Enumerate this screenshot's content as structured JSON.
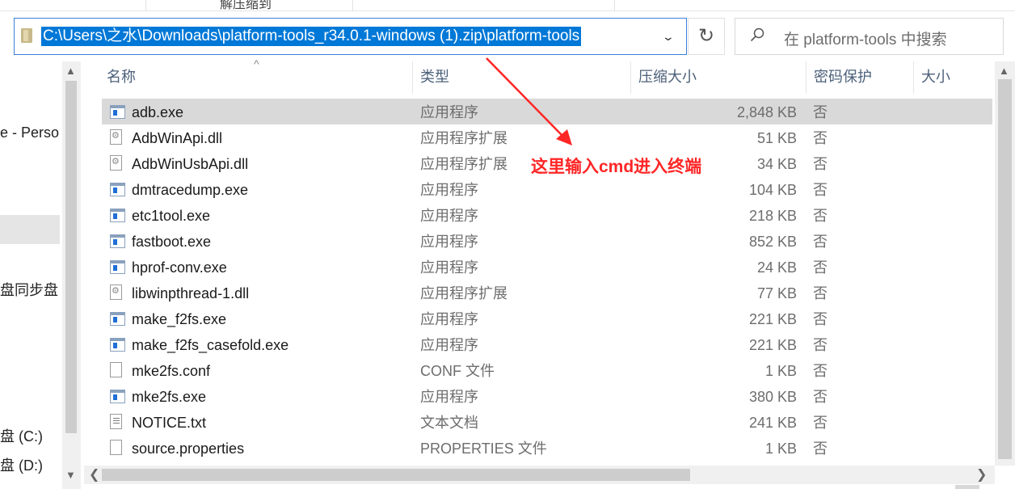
{
  "ribbon": {
    "label": "解压缩到"
  },
  "address": {
    "path": "C:\\Users\\之水\\Downloads\\platform-tools_r34.0.1-windows (1).zip\\platform-tools",
    "dropdown_icon": "chevron-down-icon",
    "refresh_icon": "refresh-icon"
  },
  "search": {
    "placeholder": "在 platform-tools 中搜索",
    "icon": "search-icon"
  },
  "nav": {
    "items": [
      {
        "label": "e - Perso"
      },
      {
        "label": "盘同步盘"
      },
      {
        "label": "盘 (C:)"
      },
      {
        "label": "盘 (D:)"
      }
    ]
  },
  "columns": {
    "name": "名称",
    "type": "类型",
    "compressed_size": "压缩大小",
    "encrypted": "密码保护",
    "size": "大小"
  },
  "files": [
    {
      "name": "adb.exe",
      "type": "应用程序",
      "size": "2,848 KB",
      "encrypted": "否",
      "icon": "exe"
    },
    {
      "name": "AdbWinApi.dll",
      "type": "应用程序扩展",
      "size": "51 KB",
      "encrypted": "否",
      "icon": "dll"
    },
    {
      "name": "AdbWinUsbApi.dll",
      "type": "应用程序扩展",
      "size": "34 KB",
      "encrypted": "否",
      "icon": "dll"
    },
    {
      "name": "dmtracedump.exe",
      "type": "应用程序",
      "size": "104 KB",
      "encrypted": "否",
      "icon": "exe"
    },
    {
      "name": "etc1tool.exe",
      "type": "应用程序",
      "size": "218 KB",
      "encrypted": "否",
      "icon": "exe"
    },
    {
      "name": "fastboot.exe",
      "type": "应用程序",
      "size": "852 KB",
      "encrypted": "否",
      "icon": "exe"
    },
    {
      "name": "hprof-conv.exe",
      "type": "应用程序",
      "size": "24 KB",
      "encrypted": "否",
      "icon": "exe"
    },
    {
      "name": "libwinpthread-1.dll",
      "type": "应用程序扩展",
      "size": "77 KB",
      "encrypted": "否",
      "icon": "dll"
    },
    {
      "name": "make_f2fs.exe",
      "type": "应用程序",
      "size": "221 KB",
      "encrypted": "否",
      "icon": "exe"
    },
    {
      "name": "make_f2fs_casefold.exe",
      "type": "应用程序",
      "size": "221 KB",
      "encrypted": "否",
      "icon": "exe"
    },
    {
      "name": "mke2fs.conf",
      "type": "CONF 文件",
      "size": "1 KB",
      "encrypted": "否",
      "icon": "doc"
    },
    {
      "name": "mke2fs.exe",
      "type": "应用程序",
      "size": "380 KB",
      "encrypted": "否",
      "icon": "exe"
    },
    {
      "name": "NOTICE.txt",
      "type": "文本文档",
      "size": "241 KB",
      "encrypted": "否",
      "icon": "txt"
    },
    {
      "name": "source.properties",
      "type": "PROPERTIES 文件",
      "size": "1 KB",
      "encrypted": "否",
      "icon": "doc"
    }
  ],
  "annotation": {
    "text": "这里输入cmd进入终端",
    "color": "#ff2626"
  },
  "colors": {
    "selection": "#0078d7",
    "row_selected": "#d9d9d9",
    "header_text": "#4c607a"
  }
}
